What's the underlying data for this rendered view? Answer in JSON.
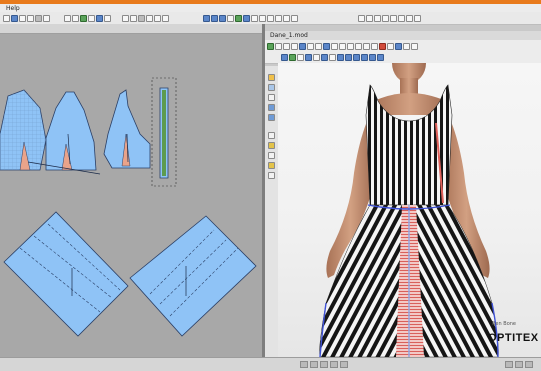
{
  "menubar": {
    "help_label": "Help"
  },
  "toolbar": {
    "groups": [
      {
        "name": "file",
        "icons": [
          "new-icon",
          "open-icon",
          "save-icon",
          "print-icon",
          "undo-icon",
          "redo-icon"
        ]
      },
      {
        "name": "edit",
        "icons": [
          "cut-icon",
          "copy-icon",
          "paste-icon",
          "delete-icon",
          "select-icon",
          "zoom-icon"
        ]
      },
      {
        "name": "tools",
        "icons": [
          "point-icon",
          "curve-icon",
          "notch-icon",
          "dart-icon",
          "measure-icon",
          "rotate-icon"
        ]
      },
      {
        "name": "view",
        "icons": [
          "grid-icon",
          "ruler-icon",
          "layers-icon",
          "piece-icon",
          "marker-icon",
          "3d-icon"
        ]
      },
      {
        "name": "right",
        "icons": [
          "help-icon",
          "settings-icon",
          "window-icon"
        ]
      }
    ]
  },
  "view3d": {
    "title": "Dane_1.mod"
  },
  "branding": {
    "logo": "OPTITEX",
    "small_text": "Ben Bone"
  },
  "colors": {
    "pattern_fill": "#8fc3f6",
    "pattern_outline": "#2a3f66",
    "canvas_bg": "#a8a8a8",
    "viewport_bg": "#f3f3f3",
    "skin": "#c89674",
    "stripe_dark": "#151515",
    "stripe_light": "#f5f5f5",
    "seam_red": "#e0605a",
    "seam_blue": "#3f52d6"
  }
}
